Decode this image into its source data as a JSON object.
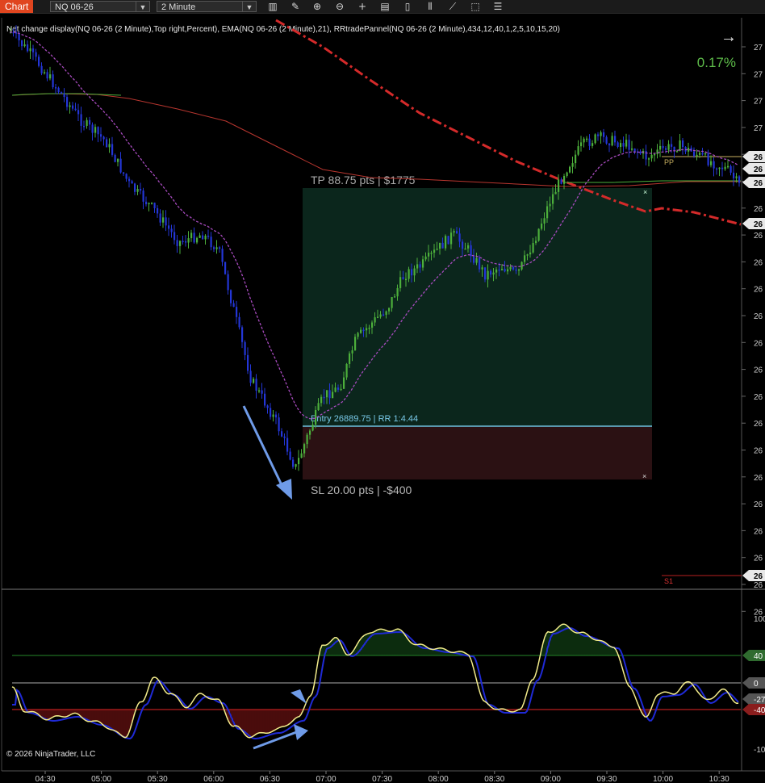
{
  "toolbar": {
    "tab_label": "Chart",
    "instrument": "NQ 06-26",
    "timeframe": "2 Minute",
    "icons": [
      "bar-type-icon",
      "pencil-icon",
      "zoom-in-icon",
      "zoom-out-icon",
      "crosshair-icon",
      "data-box-icon",
      "properties-icon",
      "indicators-icon",
      "strategies-icon",
      "export-icon",
      "list-icon"
    ]
  },
  "chart": {
    "indicator_header": "Net change display(NQ 06-26 (2 Minute),Top right,Percent), EMA(NQ 06-26 (2 Minute),21), RRtradePannel(NQ 06-26 (2 Minute),434,12,40,1,2,5,10,15,20)",
    "net_change": "0.17%",
    "net_change_color": "#5ebd4a",
    "tp_label": "TP 88.75 pts | $1775",
    "entry_label": "Entry 26889.75 | RR 1:4.44",
    "sl_label": "SL 20.00 pts | -$400",
    "pp_label": "PP",
    "s1_label": "S1",
    "copyright": "© 2026 NinjaTrader, LLC",
    "price_axis_labels": [
      "27",
      "27",
      "27",
      "27",
      "26",
      "26",
      "26",
      "26",
      "26",
      "26",
      "26",
      "26",
      "26",
      "26",
      "26",
      "26",
      "26",
      "26",
      "26",
      "26",
      "26",
      "26"
    ],
    "price_axis_tags": [
      "26",
      "26",
      "26",
      "26",
      "26"
    ],
    "colors": {
      "tp_zone": "#0b261c",
      "sl_zone": "#2b1113",
      "entry_line": "#79c9e8",
      "ema": "#a84bbf",
      "pivot_line": "#b8362f",
      "vwap_line": "#d42a2a",
      "up_candle": "#4caf3b",
      "down_candle": "#2336d6",
      "arrow": "#6f9be8"
    }
  },
  "oscillator": {
    "axis_labels": [
      "100",
      "40",
      "0",
      "-27",
      "-40",
      "-10"
    ],
    "levels": {
      "upper": 40,
      "zero": 0,
      "lower": -40
    },
    "colors": {
      "line": "#f3ec8b",
      "signal": "#1f2ad6",
      "upper": "#1f6e22",
      "lower": "#b81f1f",
      "zero": "#888888"
    }
  },
  "time_axis": [
    "04:30",
    "05:00",
    "05:30",
    "06:00",
    "06:30",
    "07:00",
    "07:30",
    "08:00",
    "08:30",
    "09:00",
    "09:30",
    "10:00",
    "10:30"
  ]
}
